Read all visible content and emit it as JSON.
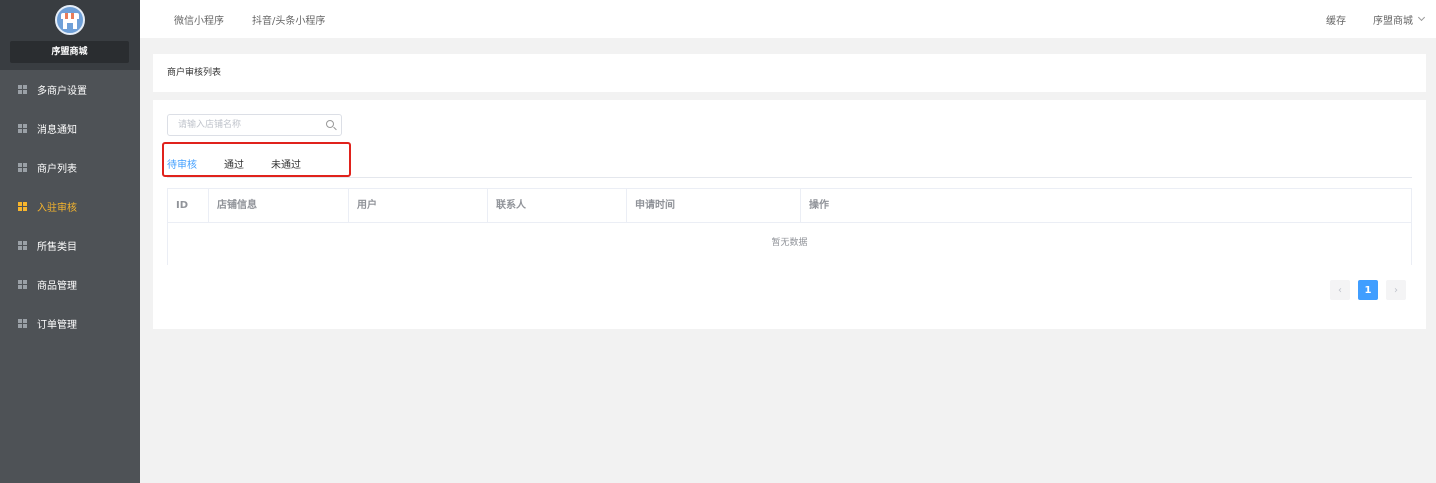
{
  "sidebar": {
    "shop_name": "序盟商城",
    "items": [
      {
        "label": "多商户设置",
        "icon": "grid-icon"
      },
      {
        "label": "消息通知",
        "icon": "grid-icon"
      },
      {
        "label": "商户列表",
        "icon": "grid-icon"
      },
      {
        "label": "入驻审核",
        "icon": "grid-icon",
        "active": true
      },
      {
        "label": "所售类目",
        "icon": "grid-icon"
      },
      {
        "label": "商品管理",
        "icon": "grid-icon"
      },
      {
        "label": "订单管理",
        "icon": "grid-icon"
      }
    ]
  },
  "header": {
    "nav": [
      "微信小程序",
      "抖音/头条小程序"
    ],
    "cache_label": "缓存",
    "user_label": "序盟商城"
  },
  "page": {
    "title": "商户审核列表",
    "search_placeholder": "请输入店铺名称",
    "tabs": [
      {
        "label": "待审核",
        "active": true
      },
      {
        "label": "通过"
      },
      {
        "label": "未通过"
      }
    ],
    "table": {
      "columns": [
        "ID",
        "店铺信息",
        "用户",
        "联系人",
        "申请时间",
        "操作"
      ],
      "empty_text": "暂无数据"
    },
    "pagination": {
      "prev": "‹",
      "current_page": "1",
      "next": "›"
    }
  },
  "colors": {
    "sidebar_bg": "#4e5256",
    "active_menu": "#f7b52c",
    "accent": "#409eff",
    "highlight_box": "#e0221c"
  }
}
